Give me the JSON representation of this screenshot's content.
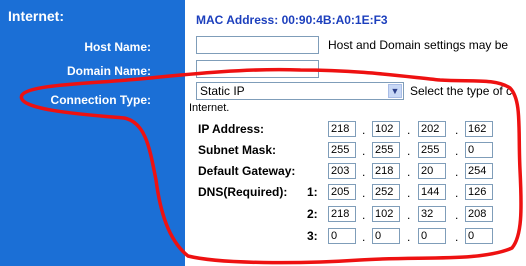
{
  "sidebar": {
    "title": "Internet:",
    "host_name_label": "Host Name:",
    "domain_name_label": "Domain Name:",
    "connection_type_label": "Connection Type:"
  },
  "main": {
    "mac_address": "MAC Address: 00:90:4B:A0:1E:F3",
    "host_hint": "Host and Domain settings may be",
    "host_value": "",
    "domain_value": "",
    "connection_type": "Static IP",
    "connection_hint": "Select the type of c",
    "internet_note": "Internet."
  },
  "ip": {
    "ip_label": "IP Address:",
    "ip": [
      "218",
      "102",
      "202",
      "162"
    ],
    "mask_label": "Subnet Mask:",
    "mask": [
      "255",
      "255",
      "255",
      "0"
    ],
    "gateway_label": "Default Gateway:",
    "gateway": [
      "203",
      "218",
      "20",
      "254"
    ],
    "dns_label": "DNS(Required):",
    "dns1_idx": "1:",
    "dns1": [
      "205",
      "252",
      "144",
      "126"
    ],
    "dns2_idx": "2:",
    "dns2": [
      "218",
      "102",
      "32",
      "208"
    ],
    "dns3_idx": "3:",
    "dns3": [
      "0",
      "0",
      "0",
      "0"
    ]
  },
  "colors": {
    "sidebar": "#1b6fd6",
    "mac": "#1c3fbd",
    "annotation": "#ee1111"
  }
}
